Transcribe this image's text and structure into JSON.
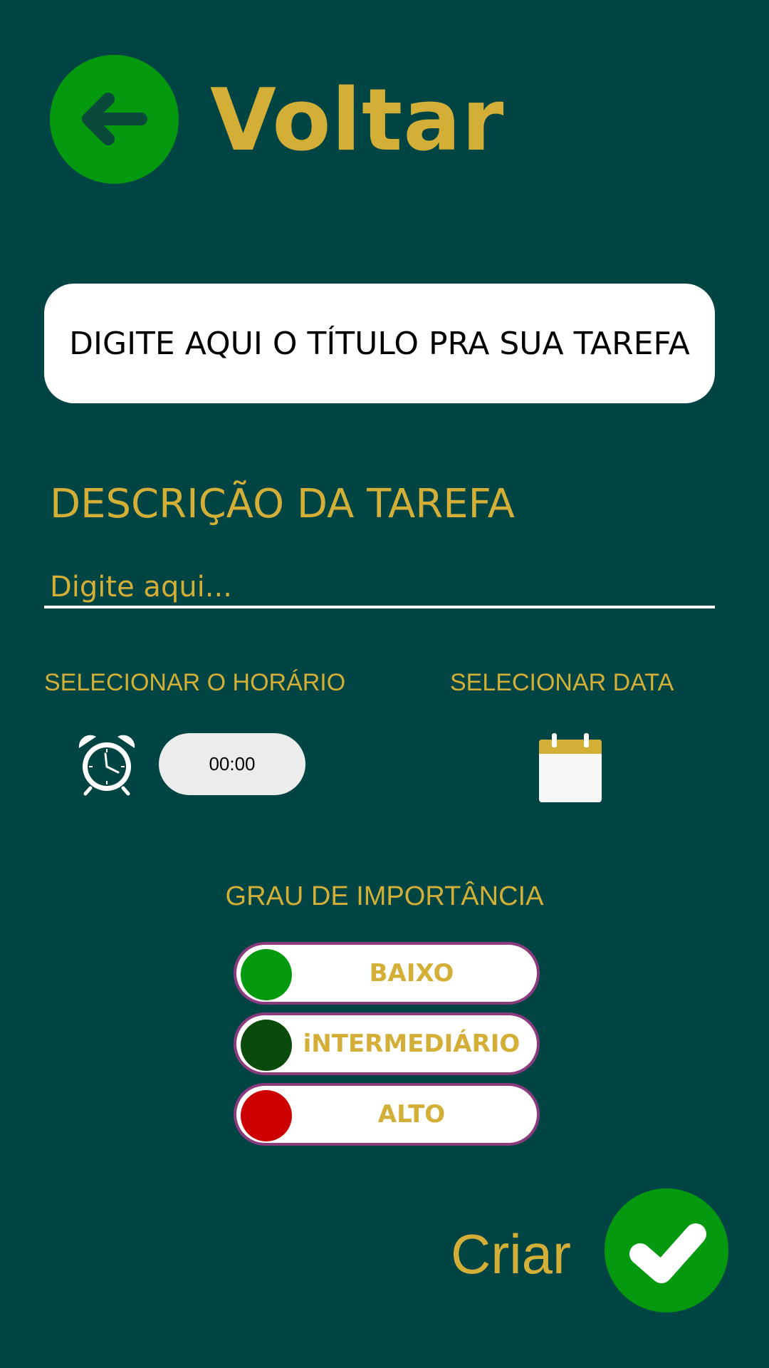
{
  "header": {
    "back_label": "Voltar",
    "back_icon": "arrow-left-icon"
  },
  "title_input": {
    "placeholder": "DIGITE AQUI O TÍTULO PRA SUA TAREFA",
    "value": ""
  },
  "description": {
    "label": "DESCRIÇÃO DA TAREFA",
    "placeholder": "Digite aqui...",
    "value": ""
  },
  "time": {
    "label": "SELECIONAR O HORÁRIO",
    "value": "00:00",
    "icon": "alarm-clock-icon"
  },
  "date": {
    "label": "SELECIONAR DATA",
    "icon": "calendar-icon"
  },
  "importance": {
    "label": "GRAU DE IMPORTÂNCIA",
    "options": [
      {
        "label": "BAIXO",
        "color": "#05990f"
      },
      {
        "label": "iNTERMEDIÁRIO",
        "color": "#0a4a0a"
      },
      {
        "label": "ALTO",
        "color": "#cc0000"
      }
    ]
  },
  "create": {
    "label": "Criar",
    "icon": "checkmark-icon"
  },
  "colors": {
    "background": "#004444",
    "accent_gold": "#d4af37",
    "button_green": "#05990f",
    "pill_border": "#8b3a7e"
  }
}
